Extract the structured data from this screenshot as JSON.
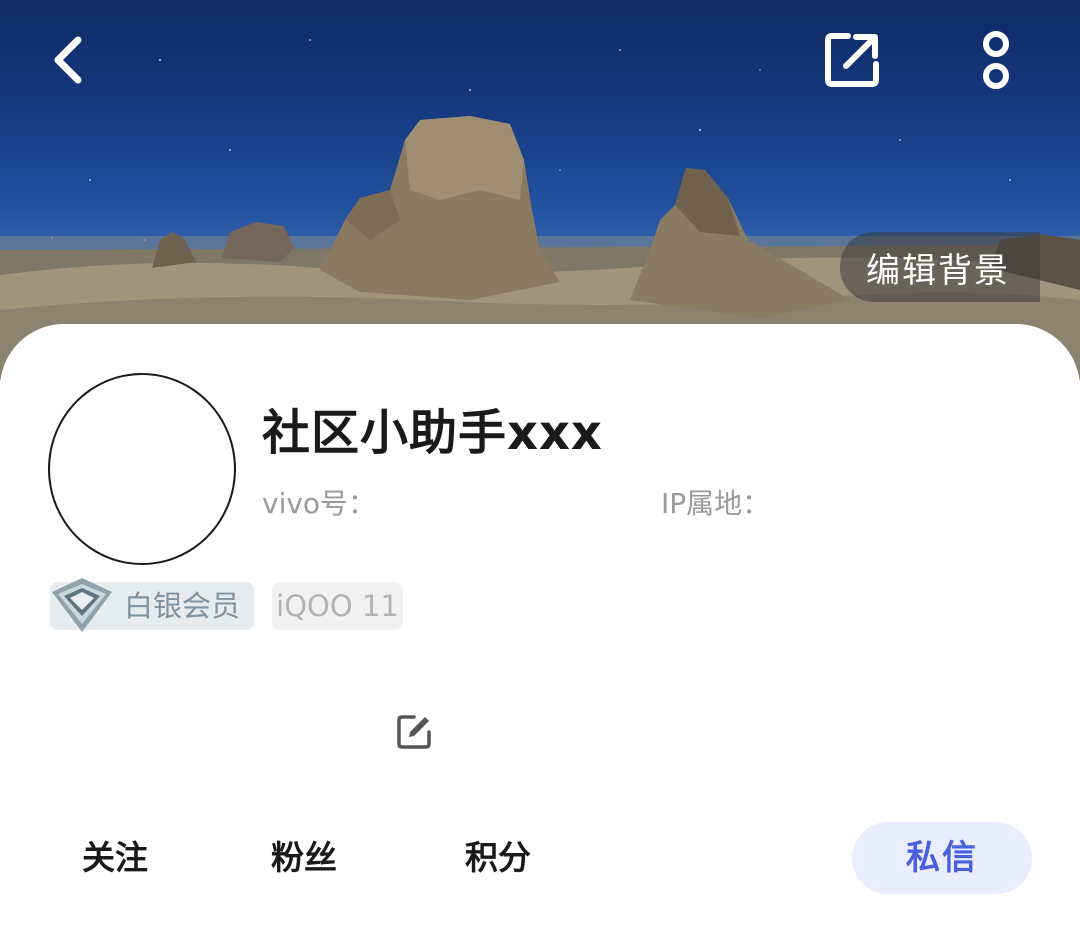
{
  "header": {
    "back_icon": "chevron-left-icon",
    "share_icon": "share-external-icon",
    "more_icon": "more-vertical-icon",
    "edit_background_label": "编辑背景"
  },
  "profile": {
    "username": "社区小助手xxx",
    "vivo_id_label": "vivo号：",
    "ip_location_label": "IP属地：",
    "member_level": "白银会员",
    "member_icon": "silver-diamond-icon",
    "device": "iQOO 11",
    "bio_edit_icon": "edit-icon"
  },
  "stats": {
    "follow_label": "关注",
    "fans_label": "粉丝",
    "points_label": "积分"
  },
  "actions": {
    "message_label": "私信"
  },
  "colors": {
    "accent": "#4a5fdc",
    "accent_bg": "#eaedfd",
    "badge_bg": "#e6ecee",
    "badge_text": "#7f93a0",
    "muted_text": "#9a9a9a"
  }
}
